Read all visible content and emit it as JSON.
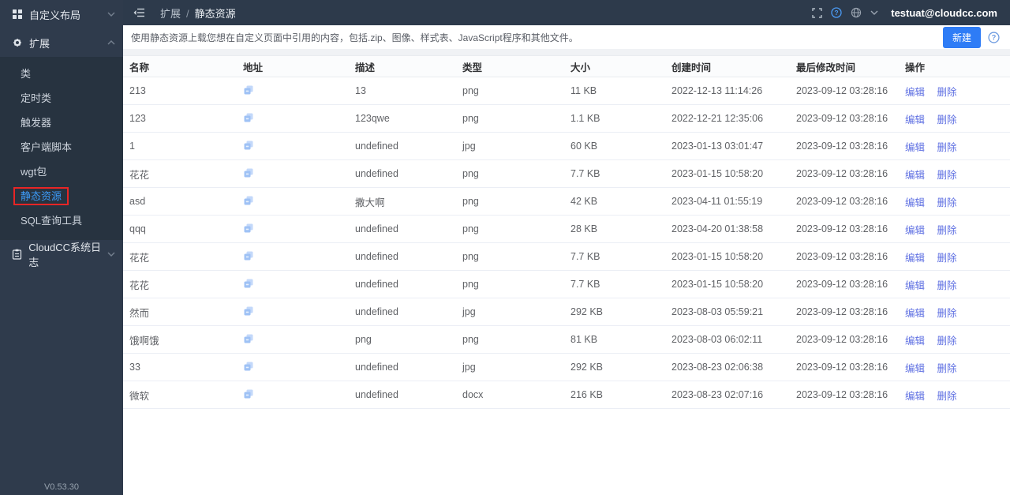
{
  "sidebar": {
    "menu": [
      {
        "label": "自定义布局",
        "icon": "grid-icon",
        "chevron": "chevron-down-icon"
      },
      {
        "label": "扩展",
        "icon": "gear-icon",
        "chevron": "chevron-up-icon"
      }
    ],
    "submenu": [
      {
        "label": "类"
      },
      {
        "label": "定时类"
      },
      {
        "label": "触发器"
      },
      {
        "label": "客户端脚本"
      },
      {
        "label": "wgt包"
      },
      {
        "label": "静态资源",
        "active": true,
        "highlight_color": "#e82525",
        "active_text_color": "#3c9bf8"
      },
      {
        "label": "SQL查询工具"
      }
    ],
    "bottom_menu": {
      "label": "CloudCC系统日志",
      "icon": "clipboard-icon",
      "chevron": "chevron-down-icon"
    },
    "version": "V0.53.30"
  },
  "header": {
    "breadcrumb": {
      "parent": "扩展",
      "separator": "/",
      "current": "静态资源"
    },
    "icons": [
      "fold-icon",
      "fullscreen-icon",
      "help-icon",
      "globe-icon",
      "chevron-down-icon"
    ],
    "user_email": "testuat@cloudcc.com"
  },
  "toolbar": {
    "new_button": "新建",
    "help_icon": "question-circle-icon",
    "accent_color": "#2e7cf6"
  },
  "description": "使用静态资源上载您想在自定义页面中引用的内容，包括.zip、图像、样式表、JavaScript程序和其他文件。",
  "table": {
    "headers": [
      "名称",
      "地址",
      "描述",
      "类型",
      "大小",
      "创建时间",
      "最后修改时间",
      "操作"
    ],
    "address_icon": "copy-icon",
    "link_color": "#5e6fe2",
    "actions": {
      "edit": "编辑",
      "delete": "删除"
    },
    "rows": [
      {
        "name": "213",
        "desc": "13",
        "type": "png",
        "size": "11 KB",
        "created": "2022-12-13 11:14:26",
        "modified": "2023-09-12 03:28:16"
      },
      {
        "name": "123",
        "desc": "123qwe",
        "type": "png",
        "size": "1.1 KB",
        "created": "2022-12-21 12:35:06",
        "modified": "2023-09-12 03:28:16"
      },
      {
        "name": "1",
        "desc": "undefined",
        "type": "jpg",
        "size": "60 KB",
        "created": "2023-01-13 03:01:47",
        "modified": "2023-09-12 03:28:16"
      },
      {
        "name": "花花",
        "desc": "undefined",
        "type": "png",
        "size": "7.7 KB",
        "created": "2023-01-15 10:58:20",
        "modified": "2023-09-12 03:28:16"
      },
      {
        "name": "asd",
        "desc": "撒大啊",
        "type": "png",
        "size": "42 KB",
        "created": "2023-04-11 01:55:19",
        "modified": "2023-09-12 03:28:16"
      },
      {
        "name": "qqq",
        "desc": "undefined",
        "type": "png",
        "size": "28 KB",
        "created": "2023-04-20 01:38:58",
        "modified": "2023-09-12 03:28:16"
      },
      {
        "name": "花花",
        "desc": "undefined",
        "type": "png",
        "size": "7.7 KB",
        "created": "2023-01-15 10:58:20",
        "modified": "2023-09-12 03:28:16"
      },
      {
        "name": "花花",
        "desc": "undefined",
        "type": "png",
        "size": "7.7 KB",
        "created": "2023-01-15 10:58:20",
        "modified": "2023-09-12 03:28:16"
      },
      {
        "name": "然而",
        "desc": "undefined",
        "type": "jpg",
        "size": "292 KB",
        "created": "2023-08-03 05:59:21",
        "modified": "2023-09-12 03:28:16"
      },
      {
        "name": "饿啊饿",
        "desc": "png",
        "type": "png",
        "size": "81 KB",
        "created": "2023-08-03 06:02:11",
        "modified": "2023-09-12 03:28:16"
      },
      {
        "name": "33",
        "desc": "undefined",
        "type": "jpg",
        "size": "292 KB",
        "created": "2023-08-23 02:06:38",
        "modified": "2023-09-12 03:28:16"
      },
      {
        "name": "微软",
        "desc": "undefined",
        "type": "docx",
        "size": "216 KB",
        "created": "2023-08-23 02:07:16",
        "modified": "2023-09-12 03:28:16"
      }
    ]
  }
}
